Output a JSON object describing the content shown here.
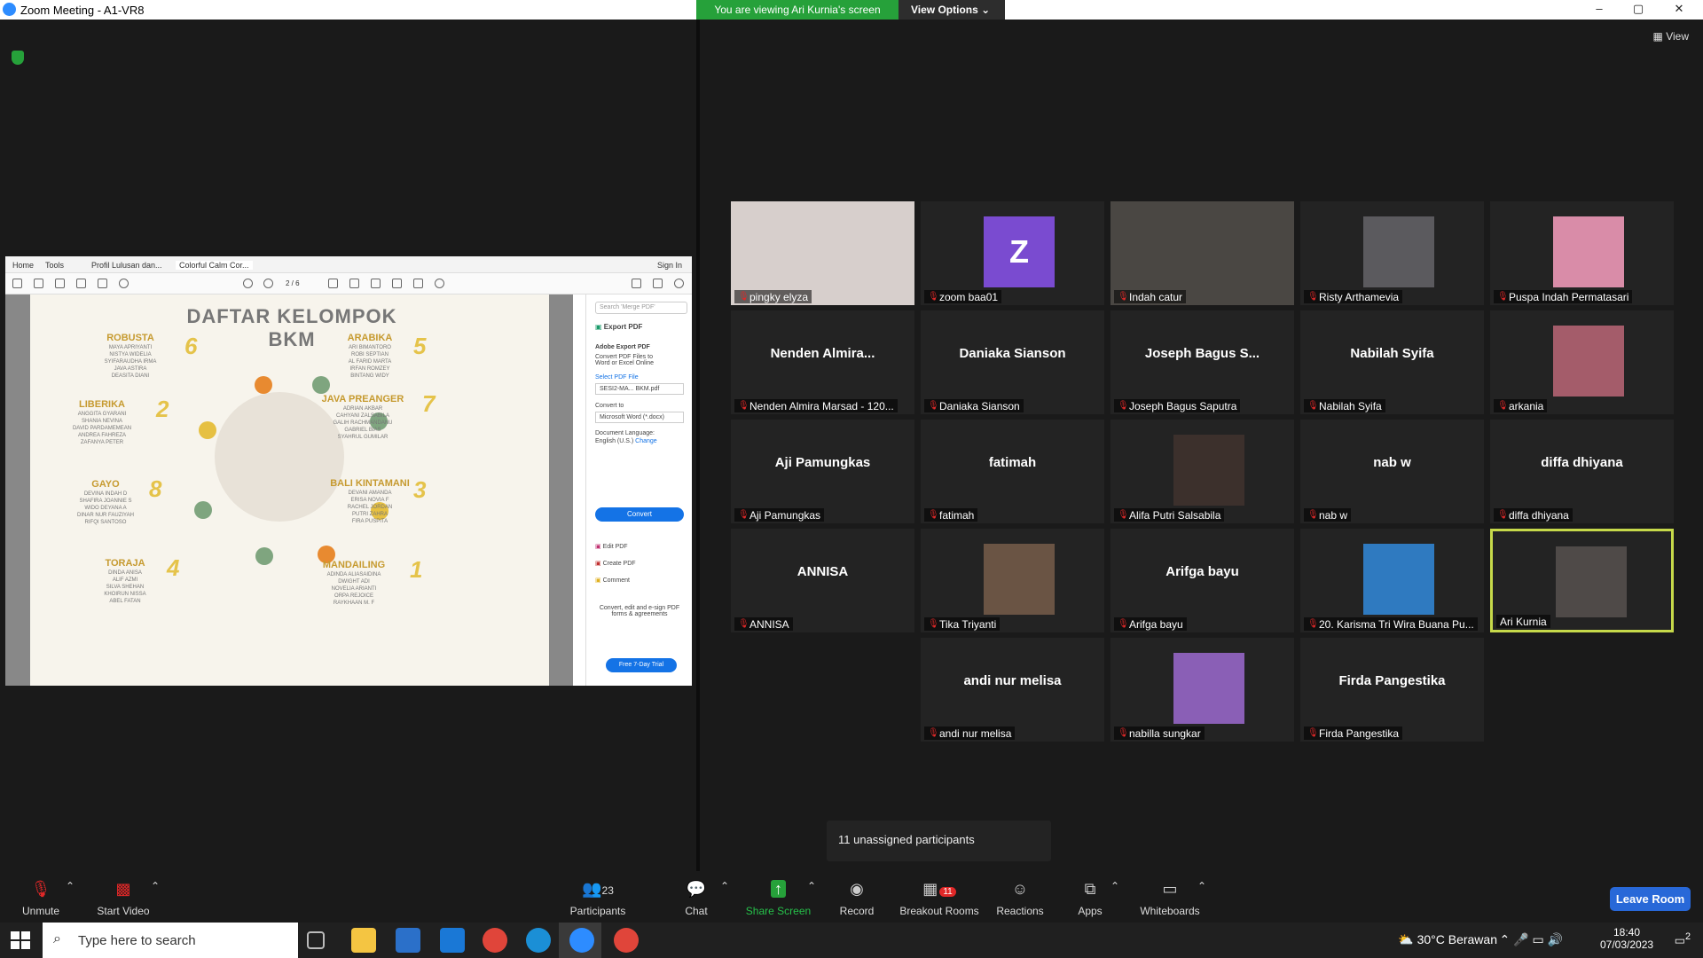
{
  "window": {
    "title": "Zoom Meeting - A1-VR8",
    "min": "–",
    "max": "▢",
    "close": "✕"
  },
  "banner": {
    "viewing": "You are viewing Ari Kurnia's screen",
    "view_options": "View Options"
  },
  "gallery": {
    "view_label": "View"
  },
  "pdf": {
    "tabs": [
      "Home",
      "Tools",
      "Profil Lulusan dan...",
      "Colorful Calm Cor..."
    ],
    "sign_in": "Sign In",
    "page_indicator": "2 / 6",
    "title_line1": "DAFTAR KELOMPOK",
    "title_line2": "BKM",
    "groups": [
      {
        "name": "ROBUSTA",
        "num": "6",
        "members": "MAYA APRIYANTI\nNISTYA WIDELIA\nSYIFARAUDHA IRMA\nJAVA ASTIRA\nDEASITA DIANI"
      },
      {
        "name": "ARABIKA",
        "num": "5",
        "members": "ARI BIMANTORO\nROBI SEPTIAN\nAL FARID MARTA\nIRFAN ROMZEY\nBINTANG WIDY"
      },
      {
        "name": "LIBERIKA",
        "num": "2",
        "members": "ANGGITA GYARANI\nSHANIA NEVINA\nDAVID PARDAMEMEAN\nANDREA FAHREZA\nZAFANYA PETER"
      },
      {
        "name": "JAVA PREANGER",
        "num": "7",
        "members": "ADRIAN AKBAR\nCAHYANI ZALSABILA\nGALIH RACHMANDANU\nGABRIEL BIAS\nSYAHRUL GUMILAR"
      },
      {
        "name": "GAYO",
        "num": "8",
        "members": "DEVINA INDAH D\nSHAFIRA JOANNIE S\nWIDO DEYANA A\nDINAR NUR FAUZIYAH\nRIFQI SANTOSO"
      },
      {
        "name": "BALI KINTAMANI",
        "num": "3",
        "members": "DEVANI AMANDA\nERISA NOVIA F\nRACHEL JORDAN\nPUTRI ZAHRA\nFIRA PUSPITA"
      },
      {
        "name": "TORAJA",
        "num": "4",
        "members": "DINDA ANISA\nALIF AZMI\nSILVA SHEHAN\nKHOIRUN NISSA\nABEL FATAN"
      },
      {
        "name": "MANDAILING",
        "num": "1",
        "members": "ADINDA ALIASAIDINA\nDWIGHT ADI\nNOVELIA ARIANTI\nORPA REJOICE\nRAYKHAAN M. F"
      }
    ],
    "side": {
      "search_placeholder": "Search 'Merge PDF'",
      "export_pdf": "Export PDF",
      "adobe_export": "Adobe Export PDF",
      "desc": "Convert PDF Files to Word or Excel Online",
      "select_file": "Select PDF File",
      "file_name": "SESI2-MA... BKM.pdf",
      "convert_to": "Convert to",
      "format": "Microsoft Word (*.docx)",
      "doc_lang": "Document Language:",
      "lang_value": "English (U.S.)",
      "change": "Change",
      "convert_btn": "Convert",
      "edit_pdf": "Edit PDF",
      "create_pdf": "Create PDF",
      "comment": "Comment",
      "promo": "Convert, edit and e-sign PDF forms & agreements",
      "trial_btn": "Free 7-Day Trial"
    }
  },
  "participants": [
    {
      "label": "pingky elyza",
      "big": "",
      "kind": "video",
      "color": "#d7cfcc"
    },
    {
      "label": "zoom baa01",
      "big": "",
      "kind": "avatar",
      "letter": "Z",
      "color": "#7a4bd0"
    },
    {
      "label": "Indah catur",
      "big": "",
      "kind": "video",
      "color": "#4a4743"
    },
    {
      "label": "Risty Arthamevia",
      "big": "",
      "kind": "pic",
      "color": "#5b5a5e"
    },
    {
      "label": "Puspa Indah Permatasari",
      "big": "",
      "kind": "pic",
      "color": "#d98ca8"
    },
    {
      "label": "Nenden Almira Marsad - 120...",
      "big": "Nenden  Almira...",
      "kind": "text"
    },
    {
      "label": "Daniaka Sianson",
      "big": "Daniaka Sianson",
      "kind": "text"
    },
    {
      "label": "Joseph Bagus Saputra",
      "big": "Joseph  Bagus  S...",
      "kind": "text"
    },
    {
      "label": "Nabilah Syifa",
      "big": "Nabilah Syifa",
      "kind": "text"
    },
    {
      "label": "arkania",
      "big": "",
      "kind": "pic",
      "color": "#a45c6a"
    },
    {
      "label": "Aji Pamungkas",
      "big": "Aji Pamungkas",
      "kind": "text"
    },
    {
      "label": "fatimah",
      "big": "fatimah",
      "kind": "text"
    },
    {
      "label": "Alifa Putri Salsabila",
      "big": "",
      "kind": "pic",
      "color": "#3c302c"
    },
    {
      "label": "nab w",
      "big": "nab w",
      "kind": "text"
    },
    {
      "label": "diffa dhiyana",
      "big": "diffa dhiyana",
      "kind": "text"
    },
    {
      "label": "ANNISA",
      "big": "ANNISA",
      "kind": "text"
    },
    {
      "label": "Tika Triyanti",
      "big": "",
      "kind": "pic",
      "color": "#6a5444"
    },
    {
      "label": "Arifga bayu",
      "big": "Arifga bayu",
      "kind": "text"
    },
    {
      "label": "20. Karisma Tri Wira Buana Pu...",
      "big": "",
      "kind": "pic",
      "color": "#2f7ac0"
    },
    {
      "label": "Ari Kurnia",
      "big": "",
      "kind": "pic",
      "color": "#4f4a48",
      "active": true
    },
    {
      "label": "andi nur melisa",
      "big": "andi nur melisa",
      "kind": "text"
    },
    {
      "label": "nabilla sungkar",
      "big": "",
      "kind": "pic",
      "color": "#8a5fb6"
    },
    {
      "label": "Firda Pangestika",
      "big": "Firda Pangestika",
      "kind": "text"
    }
  ],
  "unassigned": "11 unassigned participants",
  "toolbar": {
    "unmute": "Unmute",
    "start_video": "Start Video",
    "participants": "Participants",
    "participants_count": "23",
    "chat": "Chat",
    "share_screen": "Share Screen",
    "record": "Record",
    "breakout": "Breakout Rooms",
    "breakout_count": "11",
    "reactions": "Reactions",
    "apps": "Apps",
    "whiteboards": "Whiteboards",
    "leave": "Leave Room"
  },
  "taskbar": {
    "search_placeholder": "Type here to search",
    "weather": "30°C  Berawan",
    "time": "18:40",
    "date": "07/03/2023",
    "notif": "2"
  }
}
